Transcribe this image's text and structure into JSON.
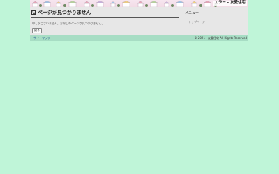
{
  "header": {
    "site_title": "エラー - 友愛住宅"
  },
  "main": {
    "title": "ページが見つかりません",
    "message": "申し訳ございません。お探しのページが見つかりません。",
    "back_button": "戻る"
  },
  "sidebar": {
    "heading": "メニュー",
    "items": [
      {
        "label": "トップページ"
      }
    ]
  },
  "footer": {
    "sitemap_link": "サイトマップ",
    "copyright": "© 2021 - 友愛住宅 All Rights Reserved"
  },
  "colors": {
    "page_background": "#bff5d8",
    "content_background": "#e7e7e7",
    "footer_background": "#a7ddc4",
    "link": "#1a4f8a"
  },
  "icons": {
    "title_icon": "broken-image-icon"
  }
}
